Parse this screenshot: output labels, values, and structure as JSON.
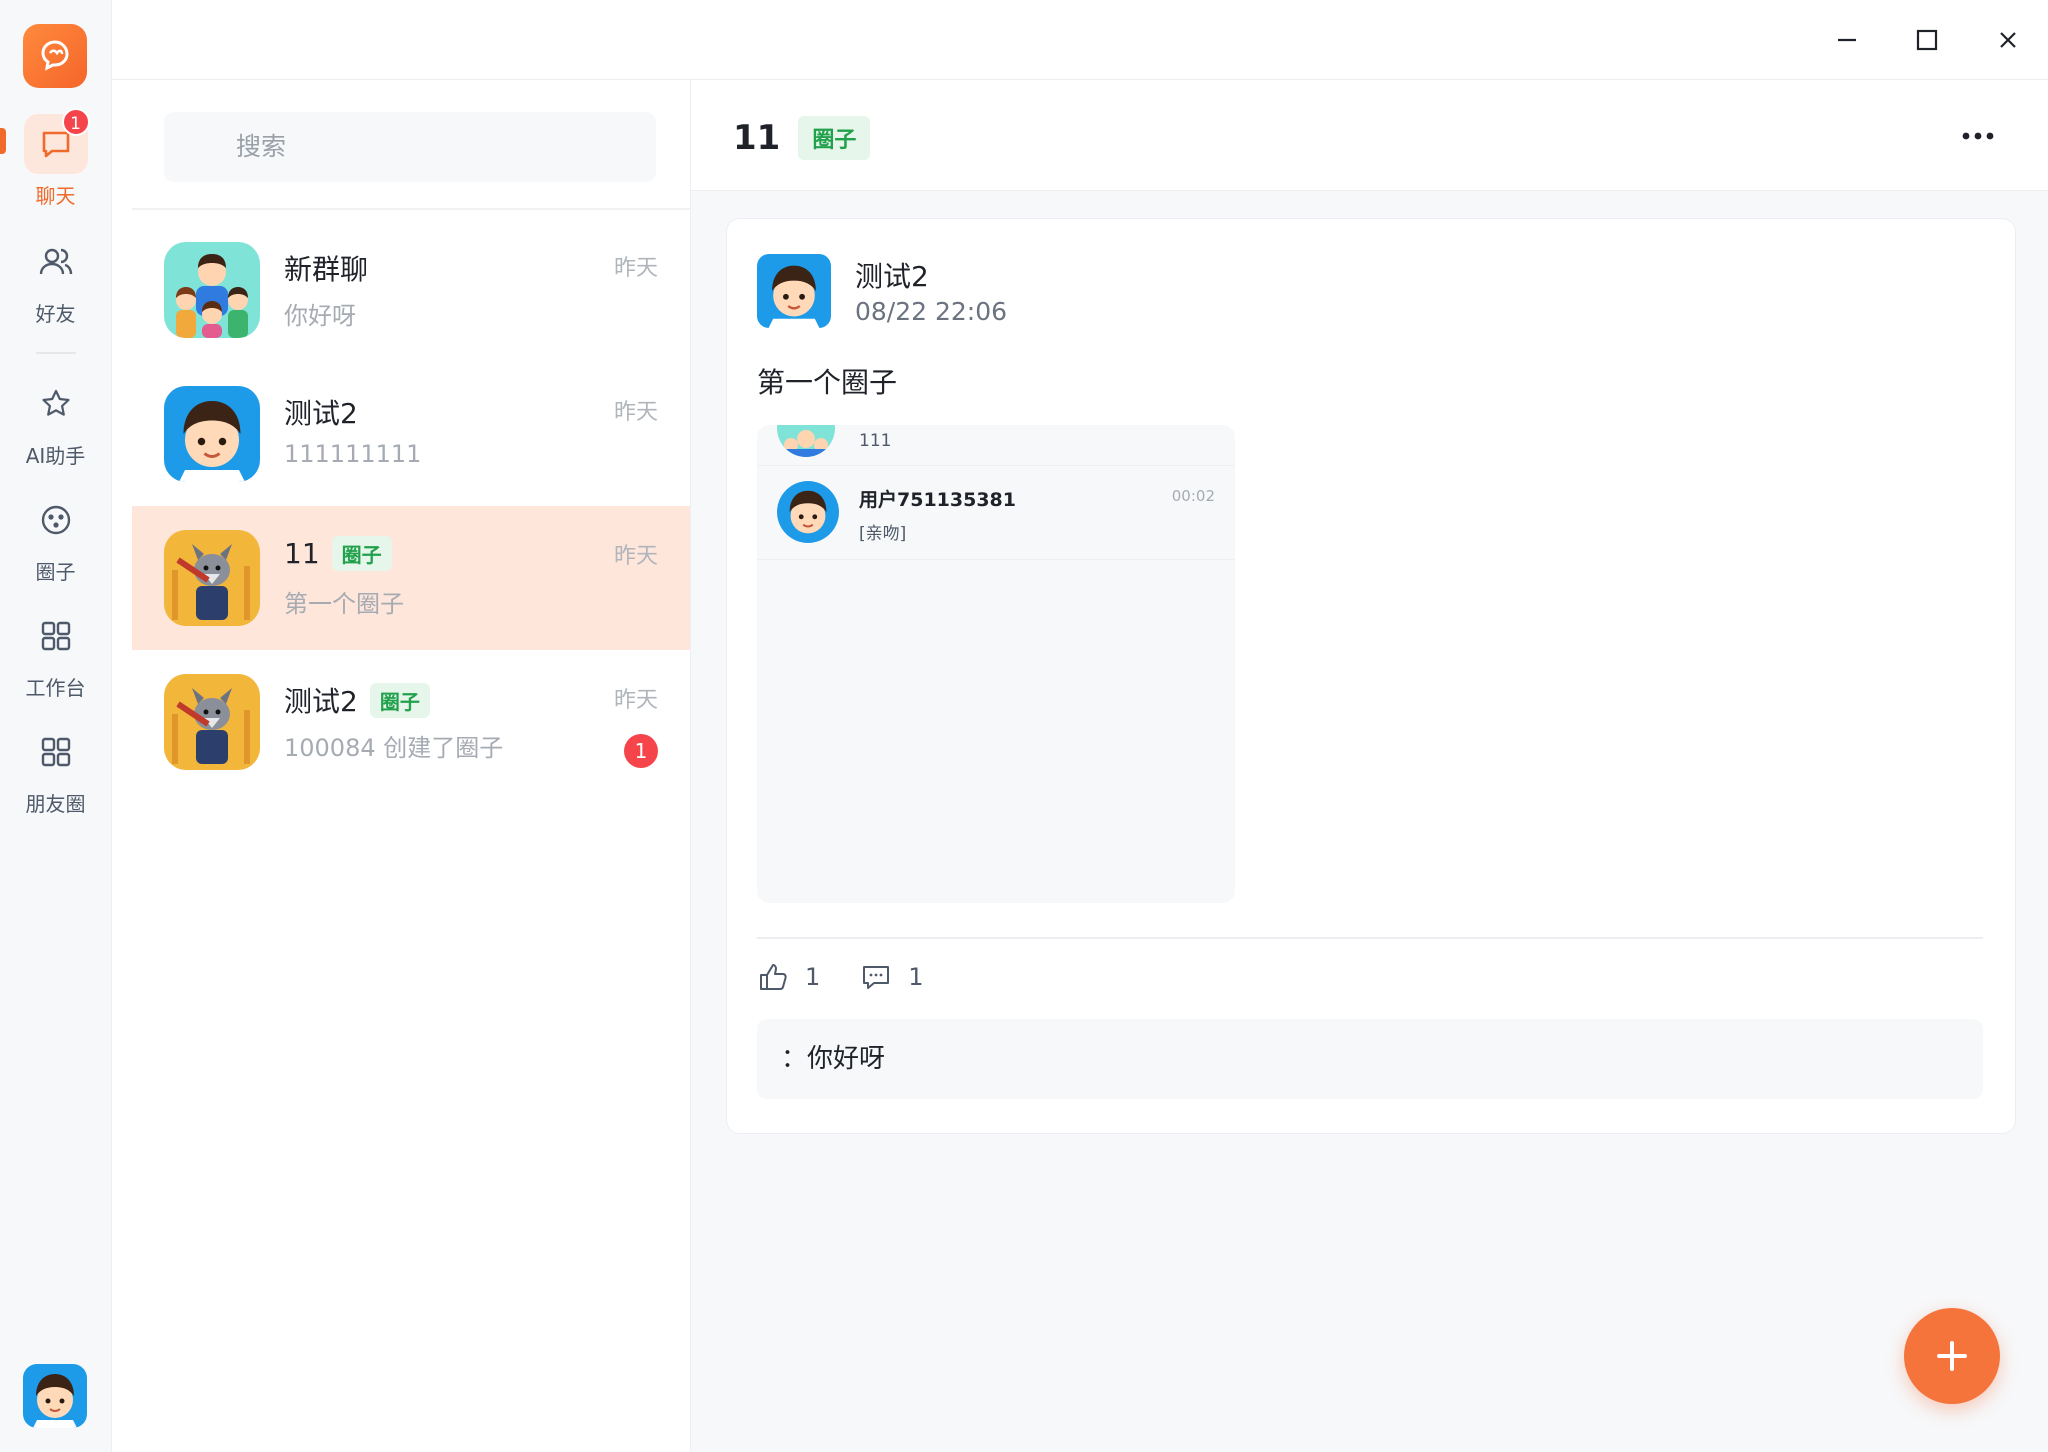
{
  "colors": {
    "accent": "#f06a2c",
    "tag_green": "#22a14d",
    "badge_red": "#f5454b"
  },
  "rail": {
    "chat": {
      "label": "聊天",
      "badge": "1"
    },
    "friends": {
      "label": "好友"
    },
    "ai": {
      "label": "AI助手"
    },
    "circle": {
      "label": "圈子"
    },
    "workbench": {
      "label": "工作台"
    },
    "moments": {
      "label": "朋友圈"
    }
  },
  "search": {
    "placeholder": "搜索"
  },
  "conversations": [
    {
      "name": "新群聊",
      "preview": "你好呀",
      "time": "昨天"
    },
    {
      "name": "测试2",
      "preview": "111111111",
      "time": "昨天"
    },
    {
      "name": "11",
      "tag": "圈子",
      "preview": "第一个圈子",
      "time": "昨天"
    },
    {
      "name": "测试2",
      "tag": "圈子",
      "preview": "100084 创建了圈子",
      "time": "昨天",
      "unread": "1"
    }
  ],
  "detail": {
    "title": "11",
    "tag": "圈子",
    "post": {
      "author": "测试2",
      "time": "08/22 22:06",
      "text": "第一个圈子",
      "embed": {
        "row1_text": "111",
        "row2_name": "用户751135381",
        "row2_msg": "[亲吻]",
        "row2_time": "00:02"
      },
      "likes": "1",
      "comments": "1",
      "comment_preview": "：你好呀"
    }
  }
}
